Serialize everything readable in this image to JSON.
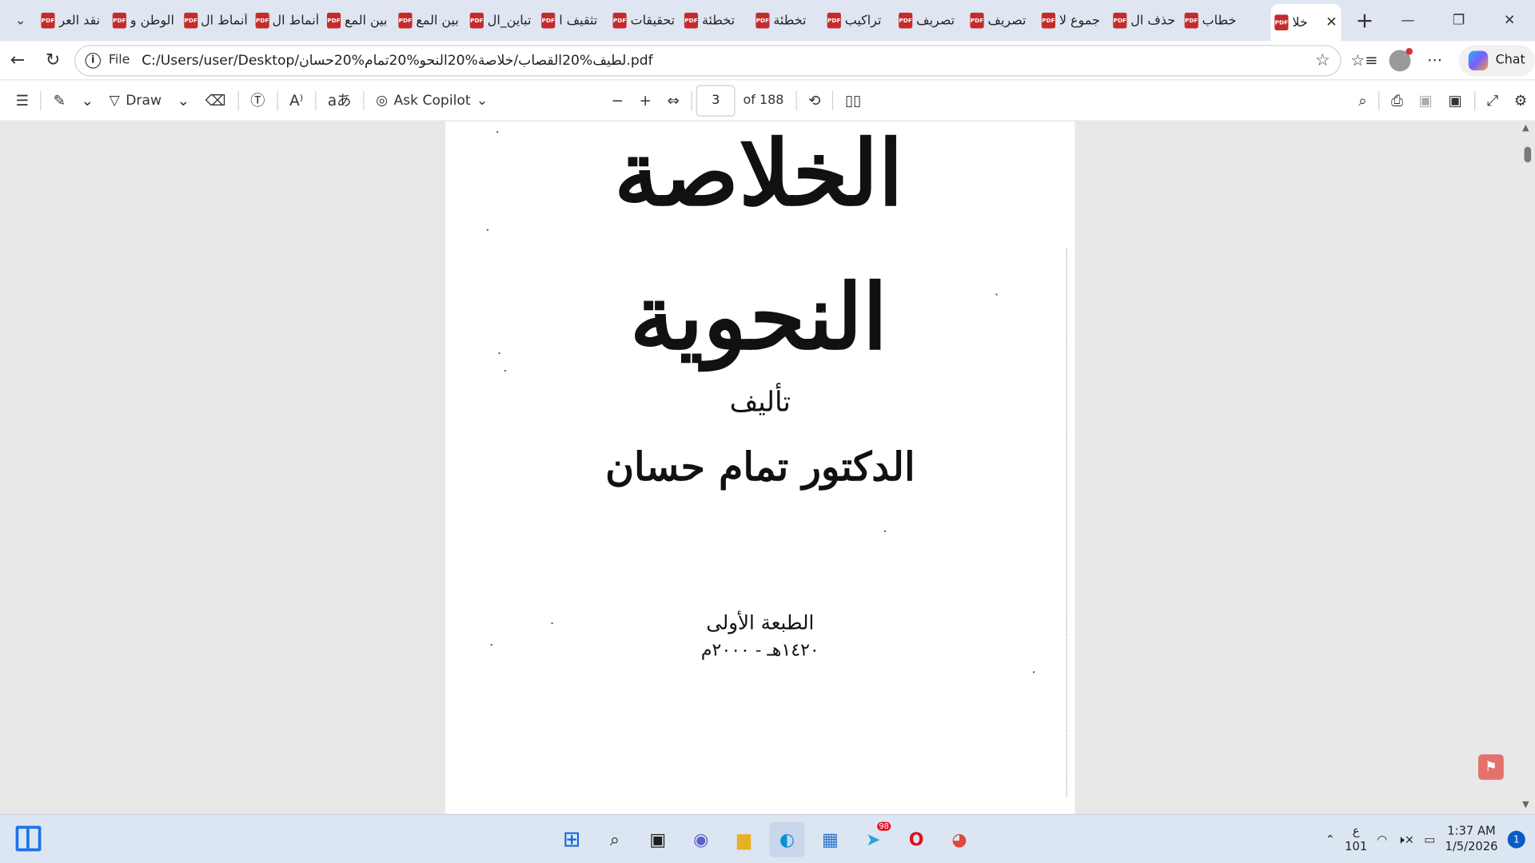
{
  "browser": {
    "tabs": [
      {
        "title": "نقد العر"
      },
      {
        "title": "الوطن و"
      },
      {
        "title": "أنماط ال"
      },
      {
        "title": "أنماط ال"
      },
      {
        "title": "بين المع"
      },
      {
        "title": "بين المع"
      },
      {
        "title": "تباين_ال"
      },
      {
        "title": "تثقيف ا"
      },
      {
        "title": "تحقيقات"
      },
      {
        "title": "تخطئة"
      },
      {
        "title": "تخطئة"
      },
      {
        "title": "تراكيب"
      },
      {
        "title": "تصريف"
      },
      {
        "title": "تصريف"
      },
      {
        "title": "جموع لا"
      },
      {
        "title": "حذف ال"
      },
      {
        "title": "خطاب"
      }
    ],
    "active_tab": {
      "title": "خلا"
    },
    "new_tab_label": "+",
    "address": {
      "scheme_label": "File",
      "url": "C:/Users/user/Desktop/لطيف%20القصاب/خلاصة%20النحو%20تمام%20حسان.pdf"
    },
    "chat_label": "Chat"
  },
  "pdf_toolbar": {
    "draw_label": "Draw",
    "ask_copilot_label": "Ask Copilot",
    "page_number": "3",
    "page_total_label": "of 188"
  },
  "document": {
    "title": "الخلاصة النحوية",
    "author_prefix": "تأليف",
    "author": "الدكتور تمام حسان",
    "edition": "الطبعة الأولى",
    "year": "١٤٢٠هـ - ٢٠٠٠م"
  },
  "taskbar": {
    "telegram_badge": "98",
    "lang_line1": "ع",
    "lang_line2": "101",
    "time": "1:37 AM",
    "date": "1/5/2026",
    "notification_count": "1"
  }
}
